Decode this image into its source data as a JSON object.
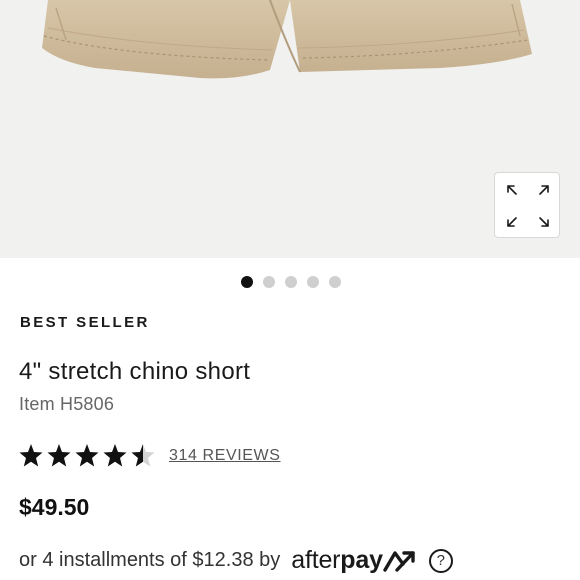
{
  "product": {
    "badge": "BEST SELLER",
    "title": "4\" stretch chino short",
    "item_number": "Item H5806",
    "rating": 4.5,
    "rating_max": 5,
    "reviews_label": "314 REVIEWS",
    "price": "$49.50"
  },
  "gallery": {
    "image_count": 5,
    "active_index": 0,
    "expand_icon": "expand-arrows-icon"
  },
  "payment": {
    "installments_text": "or 4 installments of $12.38 by",
    "provider_light": "after",
    "provider_bold": "pay",
    "help_icon": "question-circle-icon",
    "help_glyph": "?"
  },
  "colors": {
    "khaki": "#cdb99a",
    "star": "#111111"
  }
}
